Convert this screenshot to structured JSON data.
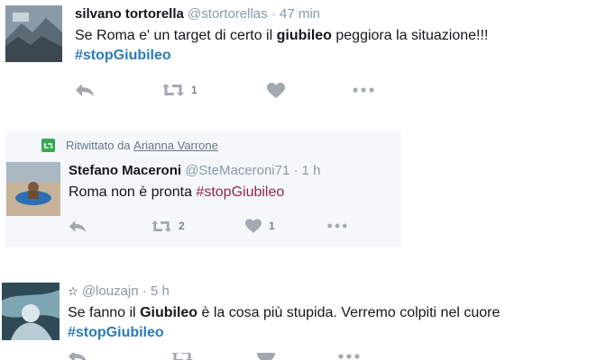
{
  "tweets": [
    {
      "name": "silvano tortorella",
      "handle": "@stortorellas",
      "time": "47 min",
      "text_before": "Se Roma e' un target di certo il ",
      "text_bold": "giubileo",
      "text_after": " peggiora la situazione!!!",
      "hashtag": "#stopGiubileo",
      "retweet_count": "1",
      "like_count": ""
    },
    {
      "retweeted_label": "Ritwittato da",
      "retweeted_by": "Arianna Varrone",
      "name": "Stefano Maceroni",
      "handle": "@SteMaceroni71",
      "time": "1 h",
      "text": "Roma non è pronta ",
      "hashtag": "#stopGiubileo",
      "retweet_count": "2",
      "like_count": "1"
    },
    {
      "star": "☆",
      "handle": "@louzajn",
      "time": "5 h",
      "text_before": "Se fanno il ",
      "text_bold": "Giubileo",
      "text_after": " è la cosa più stupida. Verremo colpiti nel cuore",
      "hashtag": "#stopGiubileo"
    }
  ],
  "separator": "·",
  "colors": {
    "link": "#2b7bb9",
    "icon": "#a2a9b0",
    "retweet_bg": "#f5f8fa",
    "retweet_badge": "#34a853"
  }
}
